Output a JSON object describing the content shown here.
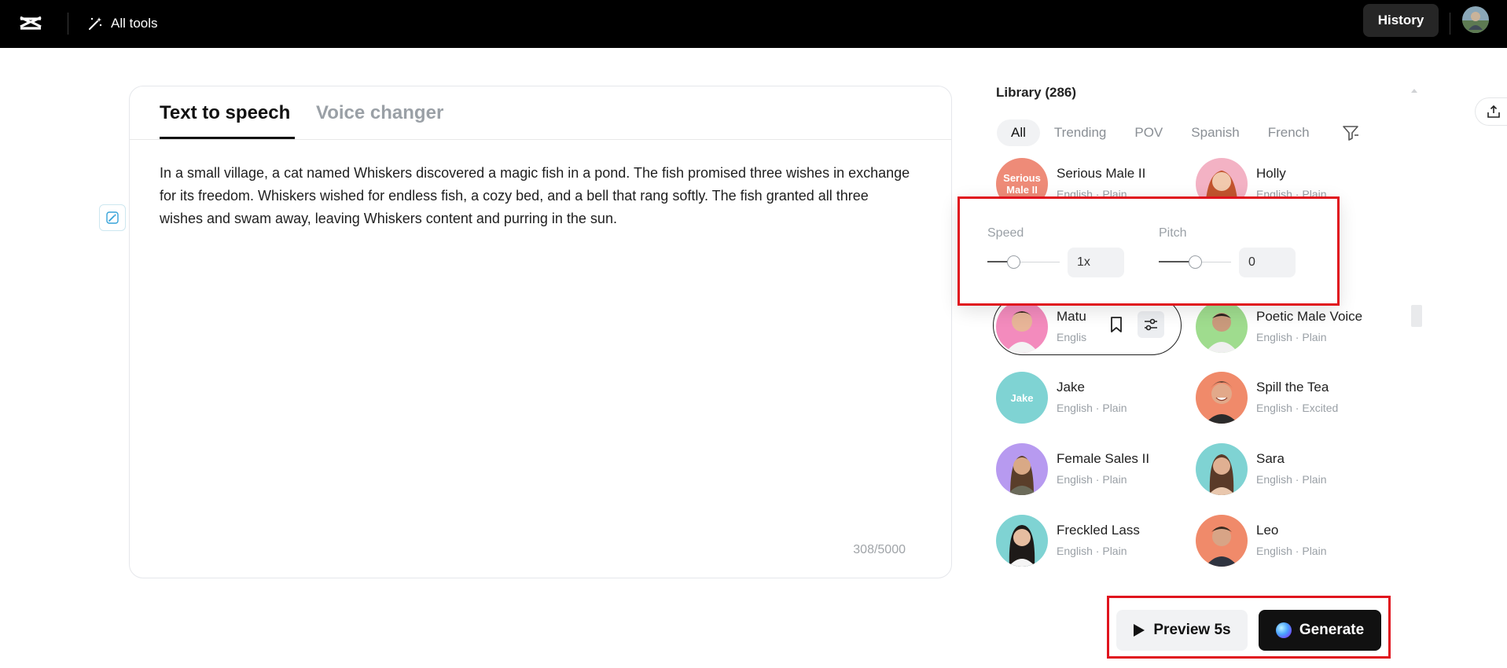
{
  "topbar": {
    "all_tools_label": "All tools",
    "history_label": "History"
  },
  "editor": {
    "tabs": [
      {
        "label": "Text to speech",
        "active": true
      },
      {
        "label": "Voice changer",
        "active": false
      }
    ],
    "text": "In a small village, a cat named Whiskers discovered a magic fish in a pond. The fish promised three wishes in exchange for its freedom. Whiskers wished for endless fish, a cozy bed, and a bell that rang softly. The fish granted all three wishes and swam away, leaving Whiskers content and purring in the sun.",
    "char_count": "308/5000"
  },
  "library": {
    "title": "Library (286)",
    "filters": [
      "All",
      "Trending",
      "POV",
      "Spanish",
      "French"
    ],
    "active_filter": "All",
    "voices": [
      {
        "name": "Serious Male II",
        "meta": "English · Plain",
        "avatar_text": "Serious Male II",
        "color": "#ee8b78"
      },
      {
        "name": "Holly",
        "meta": "English · Plain",
        "avatar_text": "",
        "color": "#f3b2c4"
      },
      {
        "name": "Matu",
        "meta": "Englis",
        "avatar_text": "",
        "color": "#f38bbd"
      },
      {
        "name": "Poetic Male Voice",
        "meta": "English · Plain",
        "avatar_text": "",
        "color": "#9fdc8e"
      },
      {
        "name": "Jake",
        "meta": "English · Plain",
        "avatar_text": "Jake",
        "color": "#7fd3d3"
      },
      {
        "name": "Spill the Tea",
        "meta": "English · Excited",
        "avatar_text": "",
        "color": "#f08a6a"
      },
      {
        "name": "Female Sales II",
        "meta": "English · Plain",
        "avatar_text": "",
        "color": "#b79af0"
      },
      {
        "name": "Sara",
        "meta": "English · Plain",
        "avatar_text": "",
        "color": "#7fd3d3"
      },
      {
        "name": "Freckled Lass",
        "meta": "English · Plain",
        "avatar_text": "",
        "color": "#7fd3d3"
      },
      {
        "name": "Leo",
        "meta": "English · Plain",
        "avatar_text": "",
        "color": "#f08a6a"
      }
    ]
  },
  "popover": {
    "speed_label": "Speed",
    "speed_value": "1x",
    "speed_level": 0.33,
    "pitch_label": "Pitch",
    "pitch_value": "0",
    "pitch_level": 0.5
  },
  "actions": {
    "preview_label": "Preview 5s",
    "generate_label": "Generate"
  },
  "colors": {
    "highlight": "#e0141e",
    "topbar": "#000000",
    "generate_bg": "#111111"
  }
}
